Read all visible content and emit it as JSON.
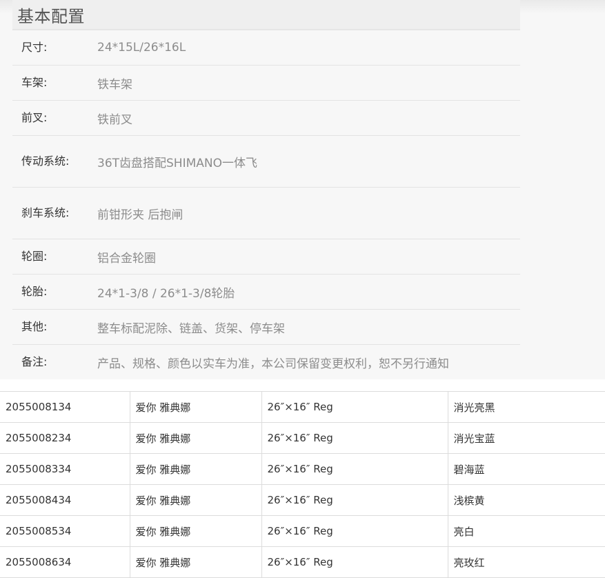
{
  "spec": {
    "title": "基本配置",
    "rows": [
      {
        "label": "尺寸:",
        "value": "24*15L/26*16L"
      },
      {
        "label": "车架:",
        "value": "铁车架"
      },
      {
        "label": "前叉:",
        "value": "铁前叉"
      },
      {
        "label": "传动系统:",
        "value": "36T齿盘搭配SHIMANO一体飞"
      },
      {
        "label": "刹车系统:",
        "value": "前钳形夹 后抱闸"
      },
      {
        "label": "轮圈:",
        "value": "铝合金轮圈"
      },
      {
        "label": "轮胎:",
        "value": "24*1-3/8 / 26*1-3/8轮胎"
      },
      {
        "label": "其他:",
        "value": "整车标配泥除、链盖、货架、停车架"
      },
      {
        "label": "备注:",
        "value": "产品、规格、颜色以实车为准，本公司保留变更权利，恕不另行通知"
      }
    ]
  },
  "sku": {
    "rows": [
      {
        "code": "2055008134",
        "name": "爱你 雅典娜",
        "size": "26″×16″ Reg",
        "color": "消光亮黑"
      },
      {
        "code": "2055008234",
        "name": "爱你 雅典娜",
        "size": "26″×16″ Reg",
        "color": "消光宝蓝"
      },
      {
        "code": "2055008334",
        "name": "爱你 雅典娜",
        "size": "26″×16″ Reg",
        "color": "碧海蓝"
      },
      {
        "code": "2055008434",
        "name": "爱你 雅典娜",
        "size": "26″×16″ Reg",
        "color": "浅槟黄"
      },
      {
        "code": "2055008534",
        "name": "爱你 雅典娜",
        "size": "26″×16″ Reg",
        "color": "亮白"
      },
      {
        "code": "2055008634",
        "name": "爱你 雅典娜",
        "size": "26″×16″ Reg",
        "color": "亮玫红"
      }
    ]
  }
}
